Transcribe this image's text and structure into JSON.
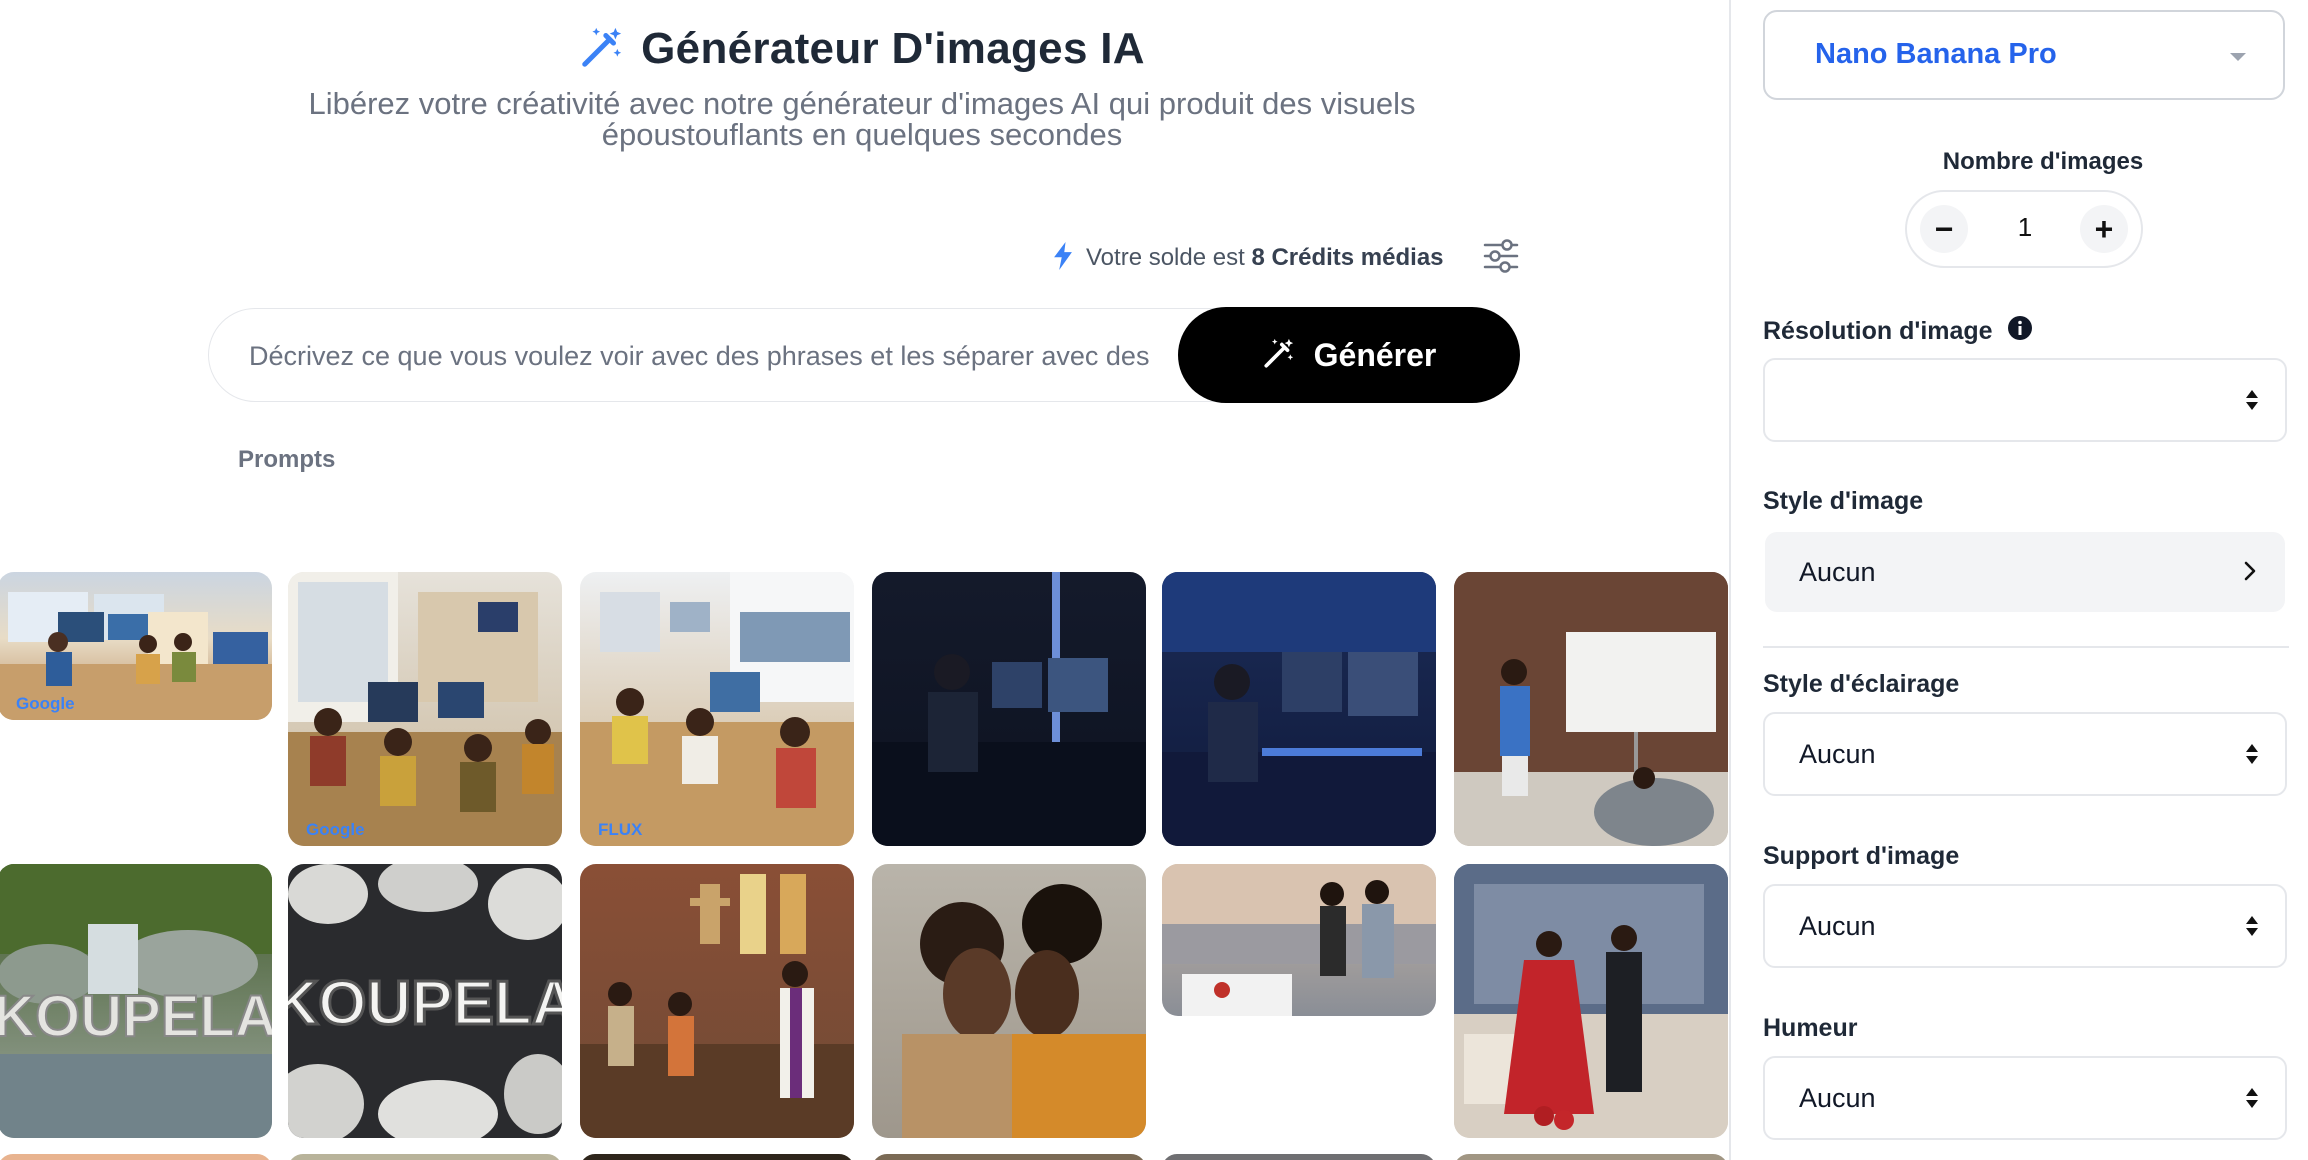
{
  "header": {
    "title": "Générateur D'images IA",
    "subtitle_line1": "Libérez votre créativité avec notre générateur d'images AI qui produit des visuels",
    "subtitle_line2": "époustouflants en quelques secondes"
  },
  "balance": {
    "prefix": "Votre solde est",
    "amount": "8 Crédits médias"
  },
  "prompt": {
    "placeholder": "Décrivez ce que vous voulez voir avec des phrases et les séparer avec des",
    "generate_label": "Générer"
  },
  "tabs": {
    "prompts": "Prompts"
  },
  "gallery": {
    "row1": [
      {
        "tag": "Google",
        "scene": "office-meeting"
      },
      {
        "tag": "Google",
        "scene": "office-computers"
      },
      {
        "tag": "FLUX",
        "scene": "team-laptops"
      },
      {
        "tag": "",
        "scene": "dark-desk"
      },
      {
        "tag": "",
        "scene": "blue-desk"
      },
      {
        "tag": "",
        "scene": "whiteboard-room"
      }
    ],
    "row2": [
      {
        "tag": "",
        "scene": "koupela-stream",
        "text": "KOUPELA"
      },
      {
        "tag": "",
        "scene": "koupela-stones",
        "text": "KOUPELA"
      },
      {
        "tag": "",
        "scene": "church"
      },
      {
        "tag": "",
        "scene": "couple-portrait"
      },
      {
        "tag": "",
        "scene": "rooftop-couple"
      },
      {
        "tag": "",
        "scene": "red-dress-couple"
      }
    ]
  },
  "panel": {
    "model": "Nano Banana Pro",
    "count_label": "Nombre d'images",
    "count_value": "1",
    "minus": "−",
    "plus": "+",
    "resolution_label": "Résolution d'image",
    "resolution_value": "",
    "style_label": "Style d'image",
    "style_value": "Aucun",
    "lighting_label": "Style d'éclairage",
    "lighting_value": "Aucun",
    "support_label": "Support d'image",
    "support_value": "Aucun",
    "mood_label": "Humeur",
    "mood_value": "Aucun"
  },
  "colors": {
    "accent": "#2563eb",
    "tag_blue": "#3b82f6",
    "button_black": "#000000"
  },
  "icons": [
    "magic-wand-icon",
    "lightning-icon",
    "sliders-icon",
    "chevron-down-icon",
    "info-icon",
    "chevron-right-icon",
    "sort-updown-icon"
  ]
}
